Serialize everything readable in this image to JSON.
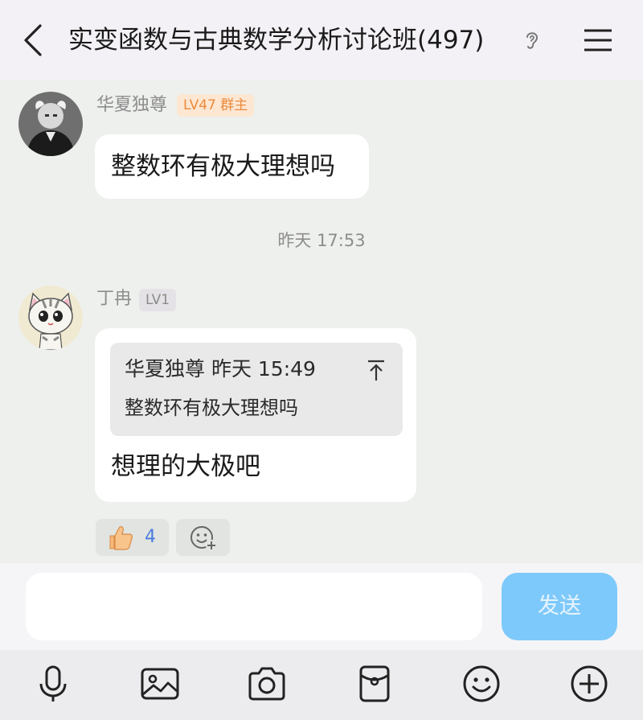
{
  "header": {
    "title": "实变函数与古典数学分析讨论班(497)"
  },
  "messages": [
    {
      "sender": "华夏独尊",
      "badge": "LV47 群主",
      "text": "整数环有极大理想吗"
    },
    {
      "sender": "丁冉",
      "badge": "LV1",
      "quote": {
        "meta": "华夏独尊 昨天 15:49",
        "text": "整数环有极大理想吗"
      },
      "text": "想理的大极吧"
    }
  ],
  "timestamp": "昨天 17:53",
  "reactions": {
    "like_count": "4"
  },
  "composer": {
    "placeholder": "",
    "send_label": "发送"
  },
  "toolbar": {
    "icons": [
      "microphone-icon",
      "image-icon",
      "camera-icon",
      "red-packet-icon",
      "emoji-icon",
      "plus-icon"
    ]
  },
  "colors": {
    "send_button": "#7ec9fb",
    "owner_badge_bg": "#fde7d2",
    "owner_badge_text": "#ec8a3c",
    "chat_background": "#eef0ed"
  }
}
